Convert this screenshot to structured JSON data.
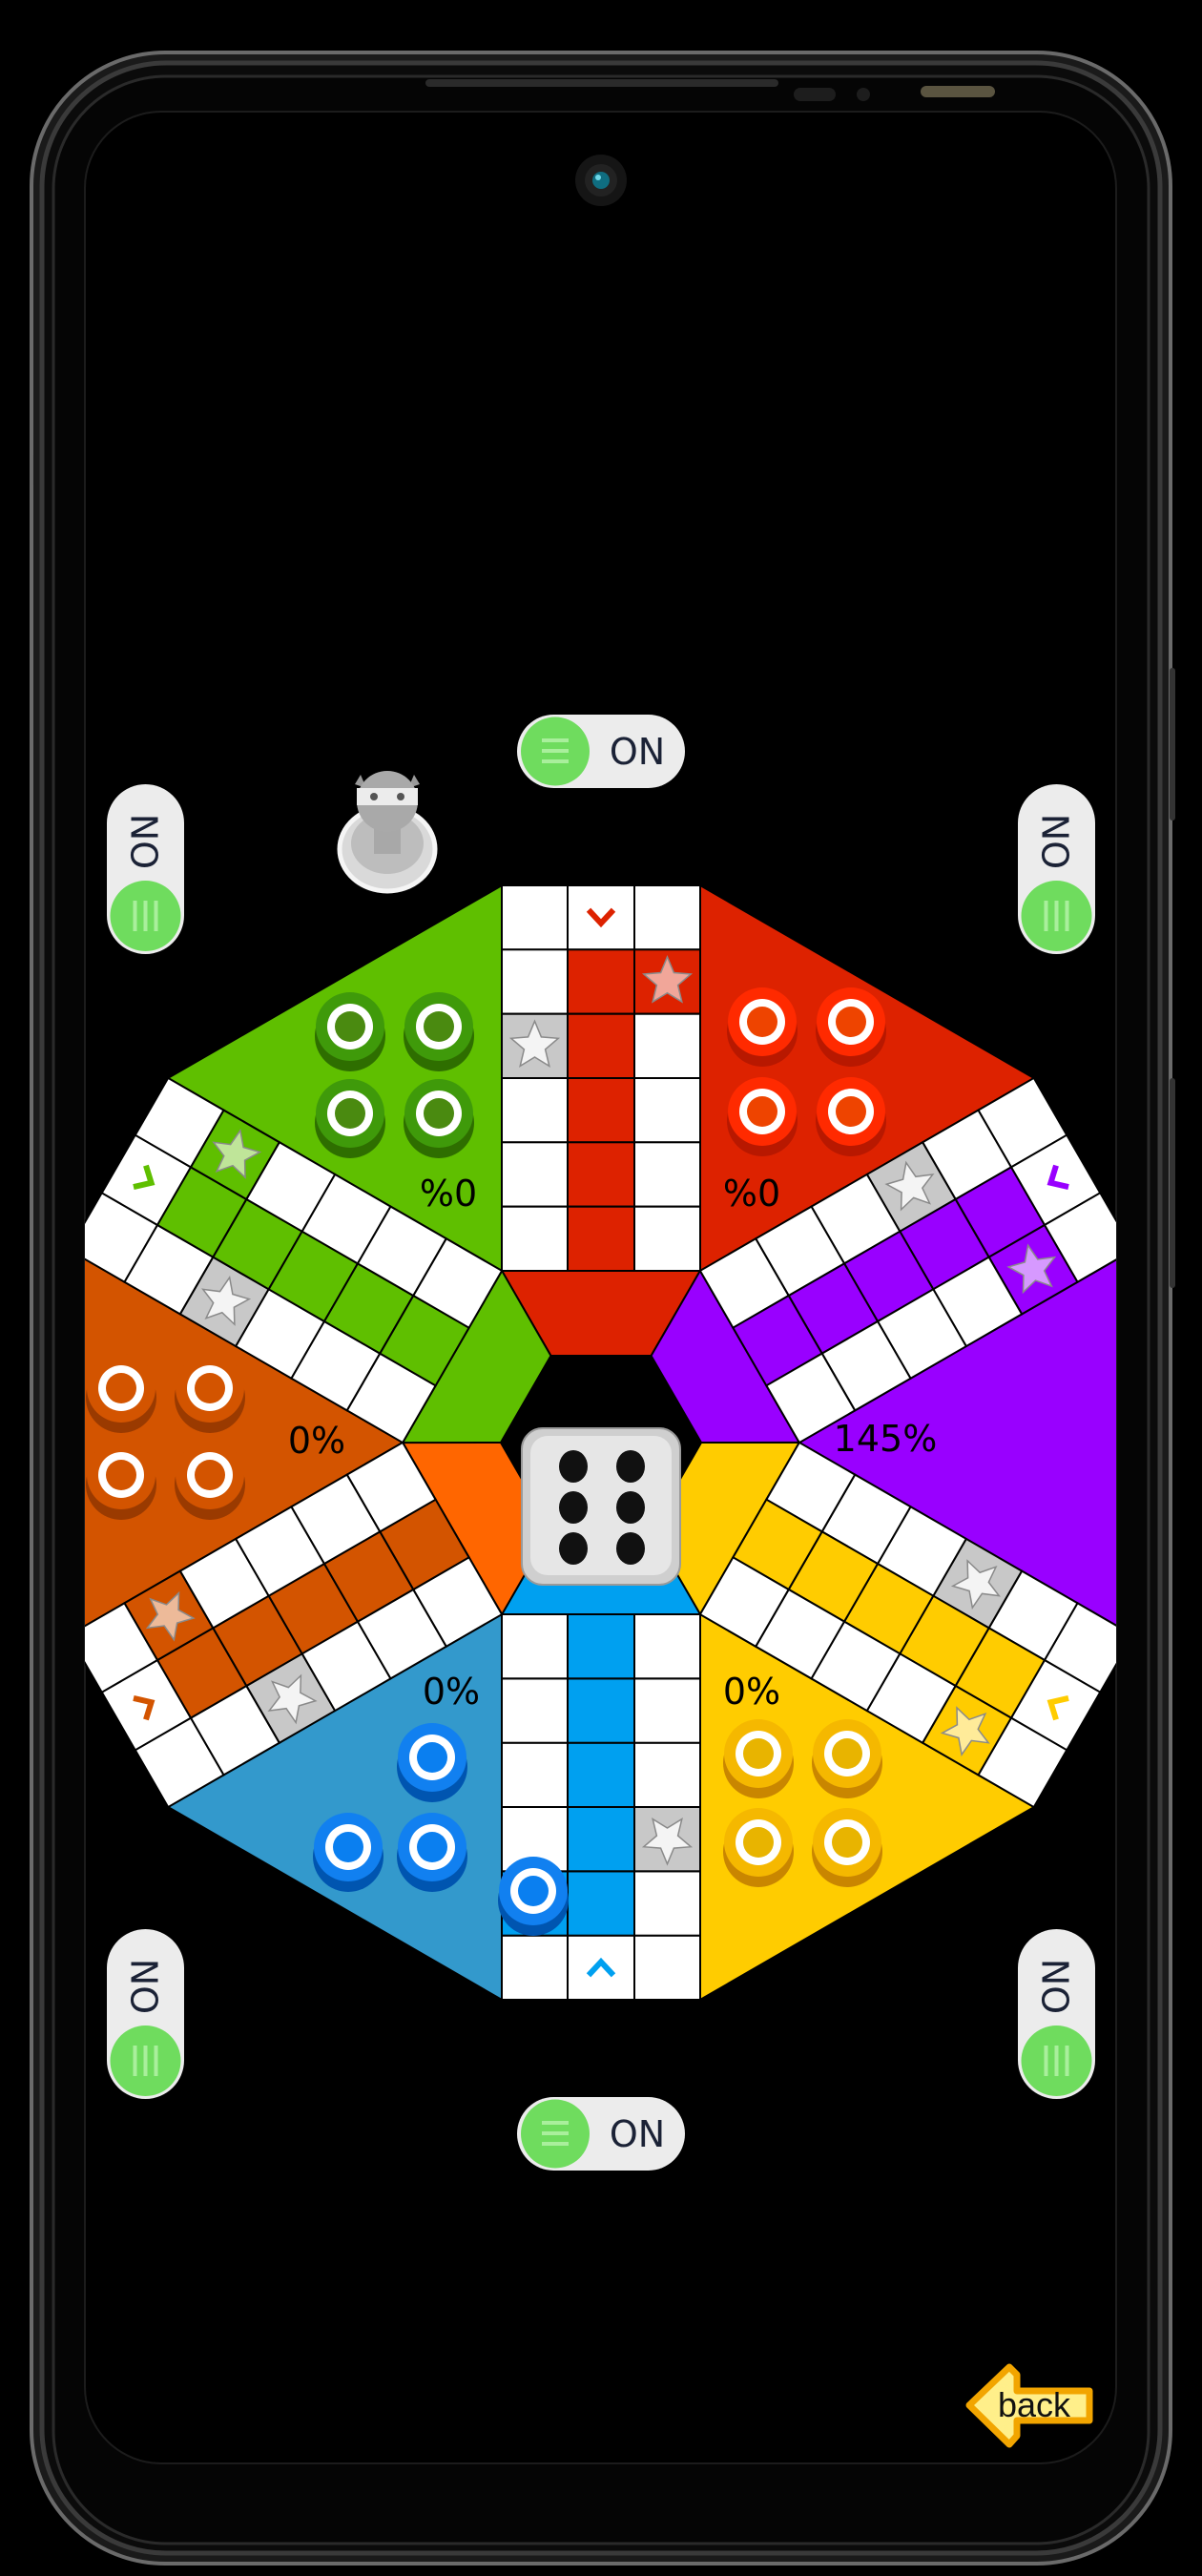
{
  "toggles": {
    "top": {
      "label": "ON",
      "state": "on"
    },
    "bottom": {
      "label": "ON",
      "state": "on"
    },
    "left_upper": {
      "label": "ON",
      "state": "on"
    },
    "right_upper": {
      "label": "ON",
      "state": "on"
    },
    "left_lower": {
      "label": "ON",
      "state": "on"
    },
    "right_lower": {
      "label": "ON",
      "state": "on"
    }
  },
  "players": [
    {
      "color_name": "red",
      "color": "#dd2200",
      "center_color": "#dd2200",
      "percent": "%0",
      "pieces_in_home": 4,
      "pieces_on_board": 0
    },
    {
      "color_name": "purple",
      "color": "#9900ff",
      "center_color": "#9900ff",
      "percent": "145%",
      "pieces_in_home": 0,
      "pieces_on_board": 0
    },
    {
      "color_name": "yellow",
      "color": "#ffcc00",
      "center_color": "#ffcc00",
      "percent": "0%",
      "pieces_in_home": 4,
      "pieces_on_board": 0
    },
    {
      "color_name": "blue",
      "color": "#3399cc",
      "track_color": "#00a0f0",
      "center_color": "#00a0f0",
      "percent": "0%",
      "pieces_in_home": 3,
      "pieces_on_board": 1
    },
    {
      "color_name": "orange",
      "color": "#d35400",
      "center_color": "#ff6600",
      "percent": "0%",
      "pieces_in_home": 4,
      "pieces_on_board": 0
    },
    {
      "color_name": "green",
      "color": "#5fbf00",
      "center_color": "#5fbf00",
      "percent": "%0",
      "pieces_in_home": 4,
      "pieces_on_board": 0
    }
  ],
  "dice": {
    "value": 6
  },
  "current_turn_icon": "robot-avatar-icon",
  "back_label": "back",
  "icons": {
    "toggle_knob": "grip-lines-icon",
    "start_cell": "star-icon",
    "entry": "chevron-icon",
    "back": "arrow-left-icon"
  }
}
